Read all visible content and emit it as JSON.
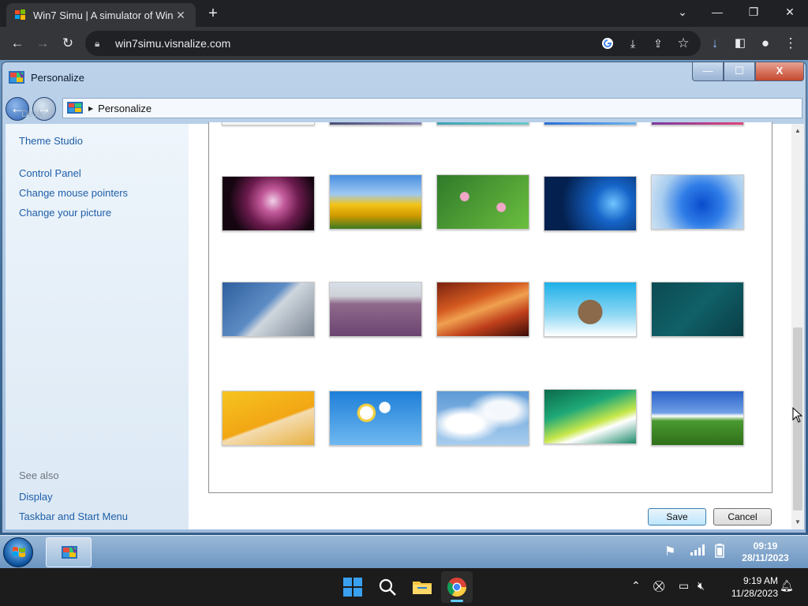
{
  "browser": {
    "tab_title": "Win7 Simu | A simulator of Wind",
    "tab_close": "✕",
    "new_tab": "+",
    "url": "win7simu.visnalize.com",
    "window_min": "—",
    "window_restore": "❐",
    "window_close": "✕"
  },
  "win7window": {
    "title": "Personalize",
    "breadcrumb": "Personalize",
    "min_glyph": "—",
    "max_glyph": "☐",
    "close_glyph": "X"
  },
  "sidebar": {
    "partial_text": "Desk",
    "links": [
      "Theme Studio",
      "Control Panel",
      "Change mouse pointers",
      "Change your picture"
    ],
    "see_also_heading": "See also",
    "see_also_links": [
      "Display",
      "Taskbar and Start Menu"
    ]
  },
  "wallpapers": [
    {
      "name": "purple-dahlia"
    },
    {
      "name": "yellow-tulips"
    },
    {
      "name": "water-lilies"
    },
    {
      "name": "windows-10-light"
    },
    {
      "name": "windows-11-bloom"
    },
    {
      "name": "silver-building"
    },
    {
      "name": "lavender-field"
    },
    {
      "name": "red-canyon"
    },
    {
      "name": "flying-island"
    },
    {
      "name": "teal-abstract"
    },
    {
      "name": "orange-windows-8"
    },
    {
      "name": "white-daisies"
    },
    {
      "name": "blue-sky-clouds"
    },
    {
      "name": "vista-aurora"
    },
    {
      "name": "bliss-hill"
    }
  ],
  "buttons": {
    "save": "Save",
    "cancel": "Cancel"
  },
  "win7_taskbar": {
    "time": "09:19",
    "date": "28/11/2023"
  },
  "host_taskbar": {
    "time": "9:19 AM",
    "date": "11/28/2023"
  },
  "colors": {
    "link": "#1f5fa8",
    "chrome_bg": "#202124",
    "accent": "#3c7fb1"
  }
}
